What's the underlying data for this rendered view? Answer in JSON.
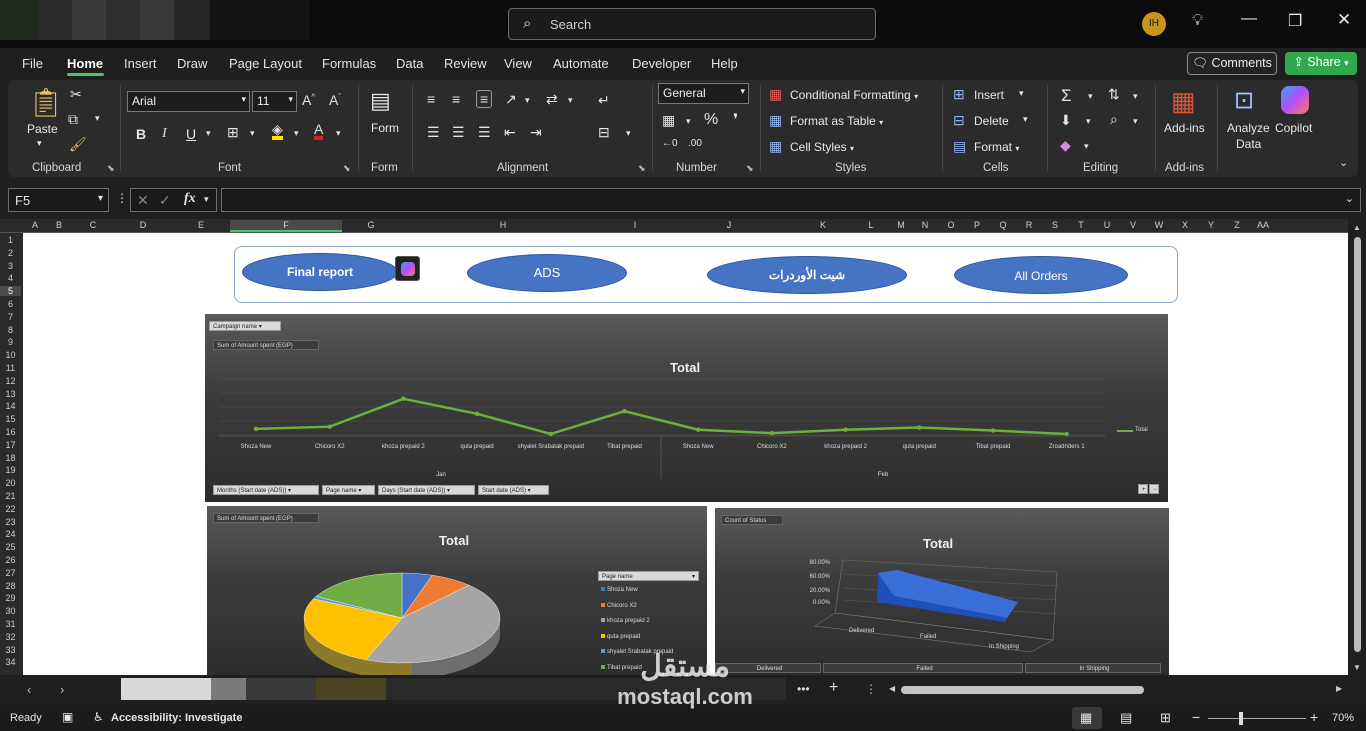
{
  "title_bar": {
    "search_placeholder": "Search",
    "avatar_initials": "IH"
  },
  "menu": {
    "tabs": [
      "File",
      "Home",
      "Insert",
      "Draw",
      "Page Layout",
      "Formulas",
      "Data",
      "Review",
      "View",
      "Automate",
      "Developer",
      "Help"
    ],
    "active_tab": "Home",
    "comments_label": "Comments",
    "share_label": "Share"
  },
  "ribbon": {
    "clipboard": {
      "paste": "Paste",
      "group": "Clipboard"
    },
    "font": {
      "name": "Arial",
      "size": "11",
      "group": "Font"
    },
    "form": {
      "label": "Form",
      "group": "Form"
    },
    "alignment": {
      "group": "Alignment"
    },
    "number": {
      "format": "General",
      "group": "Number"
    },
    "styles": {
      "conditional": "Conditional Formatting",
      "format_table": "Format as Table",
      "cell_styles": "Cell Styles",
      "group": "Styles"
    },
    "cells": {
      "insert": "Insert",
      "delete": "Delete",
      "format": "Format",
      "group": "Cells"
    },
    "editing": {
      "group": "Editing"
    },
    "addins": {
      "label": "Add-ins",
      "group": "Add-ins"
    },
    "analyze": {
      "line1": "Analyze",
      "line2": "Data"
    },
    "copilot": "Copilot"
  },
  "formula_bar": {
    "name_box": "F5",
    "fx": "fx",
    "formula": ""
  },
  "columns": [
    "A",
    "B",
    "C",
    "D",
    "E",
    "F",
    "G",
    "H",
    "I",
    "J",
    "K",
    "L",
    "M",
    "N",
    "O",
    "P",
    "Q",
    "R",
    "S",
    "T",
    "U",
    "V",
    "W",
    "X",
    "Y",
    "Z",
    "AA"
  ],
  "rows": [
    "1",
    "2",
    "3",
    "4",
    "5",
    "6",
    "7",
    "8",
    "9",
    "10",
    "11",
    "12",
    "13",
    "14",
    "15",
    "16",
    "17",
    "18",
    "19",
    "20",
    "21",
    "22",
    "23",
    "24",
    "25",
    "26",
    "27",
    "28",
    "29",
    "30",
    "31",
    "32",
    "33",
    "34"
  ],
  "nav_buttons": [
    "Final report",
    "ADS",
    "شيت الأوردرات",
    "All Orders"
  ],
  "line_chart": {
    "filter_top": "Campaign name",
    "value_field": "Sum of Amount spent (EGP)",
    "title": "Total",
    "legend": "Total",
    "groups": [
      "Jan",
      "Feb"
    ],
    "bottom_filters": [
      "Months (Start date (ADS))",
      "Page name",
      "Days (Start date (ADS))",
      "Start date (ADS)"
    ]
  },
  "pie_chart": {
    "value_field": "Sum of Amount spent (EGP)",
    "title": "Total",
    "legend_header": "Page name",
    "legend_items": [
      "Shoza New",
      "Chicoro X2",
      "khoza prepaid 2",
      "quta prepaid",
      "shyalet Srabatak prepaid",
      "Tibat prepaid"
    ]
  },
  "status_chart": {
    "value_field": "Count of Status",
    "title": "Total",
    "y_ticks": [
      "80.00%",
      "60.00%",
      "20.00%",
      "0.00%"
    ],
    "categories": [
      "Delivered",
      "Failed",
      "In Shipping"
    ]
  },
  "chart_data": [
    {
      "type": "line",
      "title": "Total",
      "categories": [
        "Shoza New",
        "Chicoro X2",
        "khoza prepaid 2",
        "quta prepaid",
        "shyalet Srabatak prepaid",
        "Tibat prepaid",
        "Shoza New",
        "Chicoro X2",
        "khoza prepaid 2",
        "quta prepaid",
        "Tibat prepaid",
        "Zroadriders 1"
      ],
      "series": [
        {
          "name": "Total",
          "values": [
            0.12,
            0.17,
            0.82,
            0.47,
            0.0,
            0.53,
            0.1,
            0.02,
            0.1,
            0.15,
            0.08,
            0.0
          ],
          "color": "#6fb03c"
        }
      ]
    },
    {
      "type": "pie",
      "title": "Total",
      "categories": [
        "Shoza New",
        "Chicoro X2",
        "khoza prepaid 2",
        "quta prepaid",
        "shyalet Srabatak prepaid",
        "Tibat prepaid"
      ],
      "values": [
        5,
        7,
        44,
        26,
        1,
        17
      ],
      "colors": [
        "#4472c4",
        "#ed7d31",
        "#a5a5a5",
        "#ffc000",
        "#5b9bd5",
        "#70ad47"
      ]
    },
    {
      "type": "area",
      "title": "Total",
      "categories": [
        "Delivered",
        "Failed",
        "In Shipping"
      ],
      "values": [
        60,
        20,
        0
      ]
    }
  ],
  "sheet_tabs": {
    "add": "+"
  },
  "status_bar": {
    "ready": "Ready",
    "accessibility": "Accessibility: Investigate",
    "zoom": "70%"
  },
  "watermark": {
    "arabic": "مستقل",
    "latin": "mostaql.com"
  },
  "colors": {
    "accent": "#4cc26d",
    "share": "#2fa84f",
    "button": "#4674c4"
  }
}
